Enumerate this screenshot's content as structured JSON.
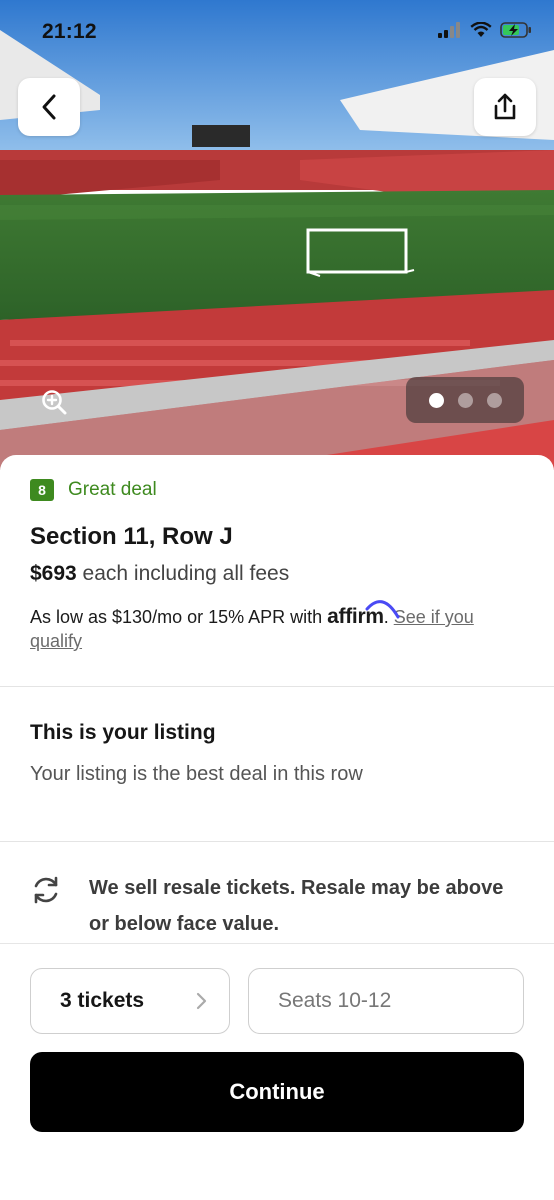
{
  "status_bar": {
    "time": "21:12"
  },
  "hero": {
    "image": "soccer stadium with red seats and goal",
    "back_icon": "chevron-left-icon",
    "share_icon": "share-icon",
    "zoom_icon": "zoom-in-icon",
    "pager": {
      "count": 3,
      "active": 1
    }
  },
  "deal": {
    "score": "8",
    "label": "Great deal",
    "color": "#3e8a1f"
  },
  "listing": {
    "section": "Section 11, Row J",
    "price": "$693",
    "price_suffix": " each including all fees",
    "financing_prefix": "As low as $130/mo or 15% APR with ",
    "affirm_logo": "affirm",
    "financing_dot": ".",
    "qualify_link": "See if you qualify"
  },
  "your_listing": {
    "title": "This is your listing",
    "subtitle": "Your listing is the best deal in this row"
  },
  "resale_notice": {
    "icon": "refresh-icon",
    "text": "We sell resale tickets. Resale may be above or below face value."
  },
  "bottom_bar": {
    "quantity_label": "3 tickets",
    "seats_label": "Seats 10-12",
    "continue_label": "Continue"
  },
  "colors": {
    "accent_green": "#3e8a1f",
    "affirm_blue": "#4a4af4",
    "primary_button": "#000000"
  }
}
